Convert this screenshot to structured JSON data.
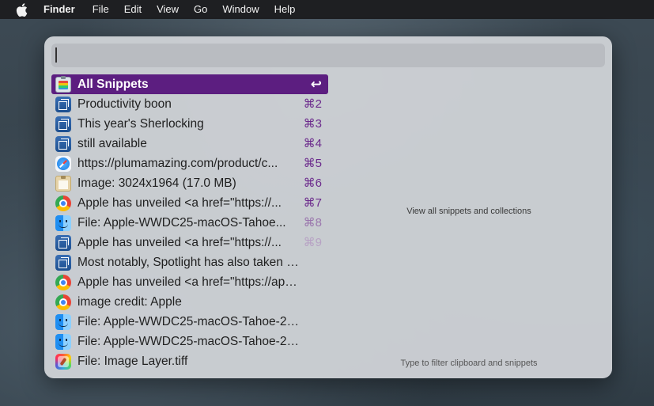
{
  "menubar": {
    "apple_icon": "apple-logo-icon",
    "items": [
      "Finder",
      "File",
      "Edit",
      "View",
      "Go",
      "Window",
      "Help"
    ]
  },
  "search": {
    "value": "",
    "placeholder": ""
  },
  "list": {
    "items": [
      {
        "icon": "snippets-clipboard-icon",
        "label": "All Snippets",
        "shortcut": "↩",
        "selected": true
      },
      {
        "icon": "window-icon",
        "label": "Productivity boon",
        "shortcut": "⌘2"
      },
      {
        "icon": "window-icon",
        "label": "This year's Sherlocking",
        "shortcut": "⌘3"
      },
      {
        "icon": "window-icon",
        "label": "still available",
        "shortcut": "⌘4"
      },
      {
        "icon": "safari-icon",
        "label": "https://plumamazing.com/product/c...",
        "shortcut": "⌘5"
      },
      {
        "icon": "clipboard-icon",
        "label": "Image: 3024x1964 (17.0 MB)",
        "shortcut": "⌘6"
      },
      {
        "icon": "chrome-icon",
        "label": "Apple has unveiled <a href=\"https://...",
        "shortcut": "⌘7"
      },
      {
        "icon": "finder-icon",
        "label": "File: Apple-WWDC25-macOS-Tahoe...",
        "shortcut": "⌘8"
      },
      {
        "icon": "window-icon",
        "label": "Apple has unveiled <a href=\"https://...",
        "shortcut": "⌘9"
      },
      {
        "icon": "window-icon",
        "label": "Most notably, Spotlight has also taken o...",
        "shortcut": ""
      },
      {
        "icon": "chrome-icon",
        "label": "Apple has unveiled <a href=\"https://appl...",
        "shortcut": ""
      },
      {
        "icon": "chrome-icon",
        "label": "image credit: Apple",
        "shortcut": ""
      },
      {
        "icon": "finder-icon",
        "label": "File: Apple-WWDC25-macOS-Tahoe-26...",
        "shortcut": ""
      },
      {
        "icon": "finder-icon",
        "label": "File: Apple-WWDC25-macOS-Tahoe-26...",
        "shortcut": ""
      },
      {
        "icon": "pixelmator-icon",
        "label": "File: Image Layer.tiff",
        "shortcut": ""
      }
    ]
  },
  "detail": {
    "hint": "View all snippets and collections",
    "footer": "Type to filter clipboard and snippets"
  },
  "colors": {
    "selection": "#5c1e80",
    "shortcut": "#6b2a8c",
    "menubar": "#1e1f22",
    "panel": "#ced1d5"
  }
}
